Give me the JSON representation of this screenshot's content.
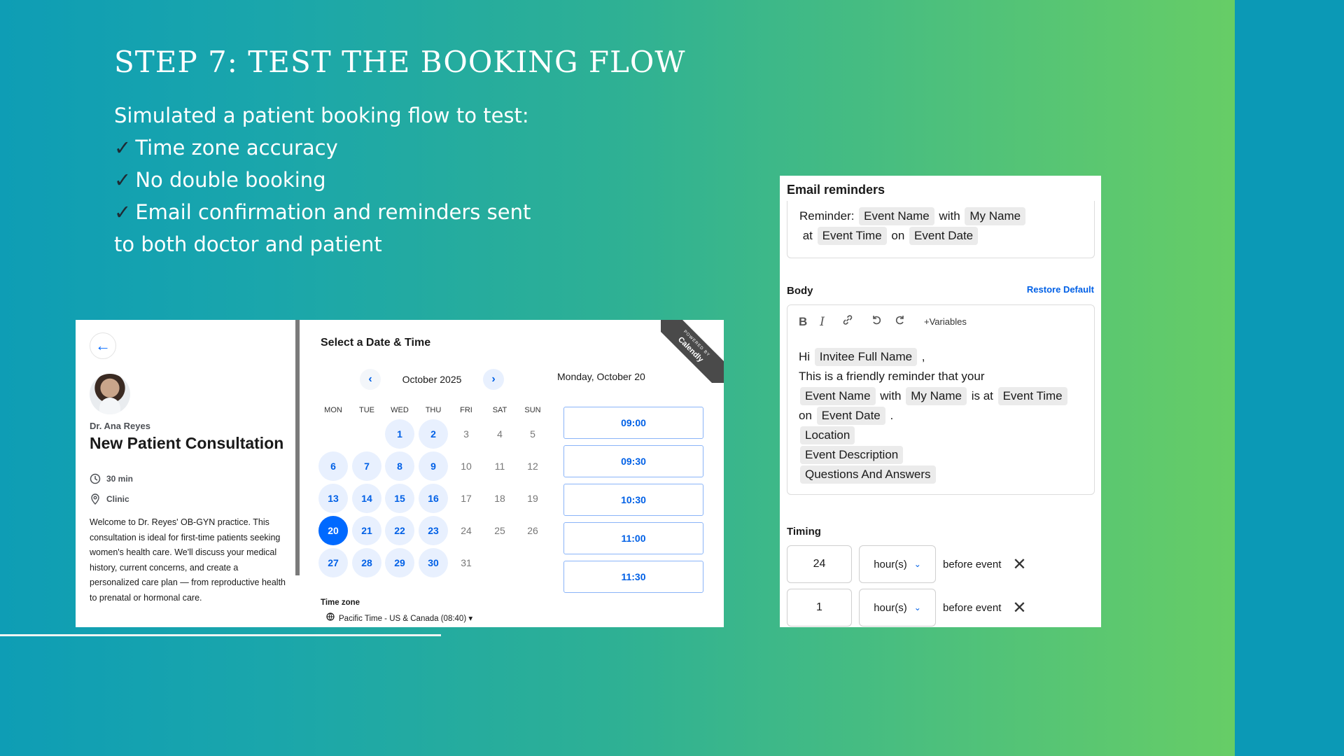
{
  "slide": {
    "title": "STEP 7: TEST THE BOOKING FLOW",
    "intro": "Simulated a patient booking flow to test:",
    "checks": [
      "Time zone accuracy",
      "No double booking",
      "Email confirmation and reminders sent to both doctor and patient"
    ],
    "check_glyph": "✓"
  },
  "calendly": {
    "doctor_name": "Dr. Ana Reyes",
    "event_title": "New Patient Consultation",
    "duration": "30 min",
    "location": "Clinic",
    "description": "Welcome to Dr. Reyes' OB-GYN practice. This consultation is ideal for first-time patients seeking women's health care. We'll discuss your medical history, current concerns, and create a personalized care plan — from reproductive health to prenatal or hormonal care.",
    "picker_title": "Select a Date & Time",
    "month_label": "October 2025",
    "weekdays": [
      "MON",
      "TUE",
      "WED",
      "THU",
      "FRI",
      "SAT",
      "SUN"
    ],
    "weeks": [
      [
        null,
        null,
        {
          "d": "1",
          "s": "avail"
        },
        {
          "d": "2",
          "s": "avail"
        },
        {
          "d": "3",
          "s": ""
        },
        {
          "d": "4",
          "s": ""
        },
        {
          "d": "5",
          "s": ""
        }
      ],
      [
        {
          "d": "6",
          "s": "avail"
        },
        {
          "d": "7",
          "s": "avail"
        },
        {
          "d": "8",
          "s": "avail"
        },
        {
          "d": "9",
          "s": "avail"
        },
        {
          "d": "10",
          "s": ""
        },
        {
          "d": "11",
          "s": ""
        },
        {
          "d": "12",
          "s": ""
        }
      ],
      [
        {
          "d": "13",
          "s": "avail"
        },
        {
          "d": "14",
          "s": "avail"
        },
        {
          "d": "15",
          "s": "avail"
        },
        {
          "d": "16",
          "s": "avail"
        },
        {
          "d": "17",
          "s": ""
        },
        {
          "d": "18",
          "s": ""
        },
        {
          "d": "19",
          "s": ""
        }
      ],
      [
        {
          "d": "20",
          "s": "sel"
        },
        {
          "d": "21",
          "s": "avail"
        },
        {
          "d": "22",
          "s": "avail"
        },
        {
          "d": "23",
          "s": "avail"
        },
        {
          "d": "24",
          "s": ""
        },
        {
          "d": "25",
          "s": ""
        },
        {
          "d": "26",
          "s": ""
        }
      ],
      [
        {
          "d": "27",
          "s": "avail"
        },
        {
          "d": "28",
          "s": "avail"
        },
        {
          "d": "29",
          "s": "avail"
        },
        {
          "d": "30",
          "s": "avail"
        },
        {
          "d": "31",
          "s": ""
        },
        null,
        null
      ]
    ],
    "timezone_label": "Time zone",
    "timezone_value": "Pacific Time - US & Canada (08:40) ▾",
    "selected_date_heading": "Monday, October 20",
    "time_slots": [
      "09:00",
      "09:30",
      "10:30",
      "11:00",
      "11:30"
    ],
    "ribbon_small": "POWERED BY",
    "ribbon_brand": "Calendly",
    "accent_color": "#0069ff"
  },
  "email": {
    "title": "Email reminders",
    "subject_parts": [
      {
        "t": "Reminder: ",
        "chip": false
      },
      {
        "t": "Event Name",
        "chip": true
      },
      {
        "t": " with ",
        "chip": false
      },
      {
        "t": "My Name",
        "chip": true
      },
      {
        "t": " at ",
        "chip": false
      },
      {
        "t": "Event Time",
        "chip": true
      },
      {
        "t": " on ",
        "chip": false
      },
      {
        "t": "Event Date",
        "chip": true
      }
    ],
    "body_label": "Body",
    "restore_label": "Restore Default",
    "variables_label": "Variables",
    "body_parts": [
      {
        "t": "Hi ",
        "chip": false
      },
      {
        "t": "Invitee Full Name",
        "chip": true
      },
      {
        "t": " ,",
        "chip": false
      },
      {
        "br": true
      },
      {
        "t": "This is a friendly reminder that your",
        "chip": false
      },
      {
        "br": true
      },
      {
        "t": "Event Name",
        "chip": true
      },
      {
        "t": " with ",
        "chip": false
      },
      {
        "t": "My Name",
        "chip": true
      },
      {
        "t": " is at ",
        "chip": false
      },
      {
        "t": "Event Time",
        "chip": true
      },
      {
        "br": true
      },
      {
        "t": "on ",
        "chip": false
      },
      {
        "t": "Event Date",
        "chip": true
      },
      {
        "t": " .",
        "chip": false
      },
      {
        "br": true
      },
      {
        "t": "Location",
        "chip": true
      },
      {
        "br": true
      },
      {
        "t": "Event Description",
        "chip": true
      },
      {
        "br": true
      },
      {
        "t": "Questions And Answers",
        "chip": true
      }
    ],
    "timing_label": "Timing",
    "timings": [
      {
        "value": "24",
        "unit": "hour(s)",
        "suffix": "before event"
      },
      {
        "value": "1",
        "unit": "hour(s)",
        "suffix": "before event"
      }
    ]
  }
}
